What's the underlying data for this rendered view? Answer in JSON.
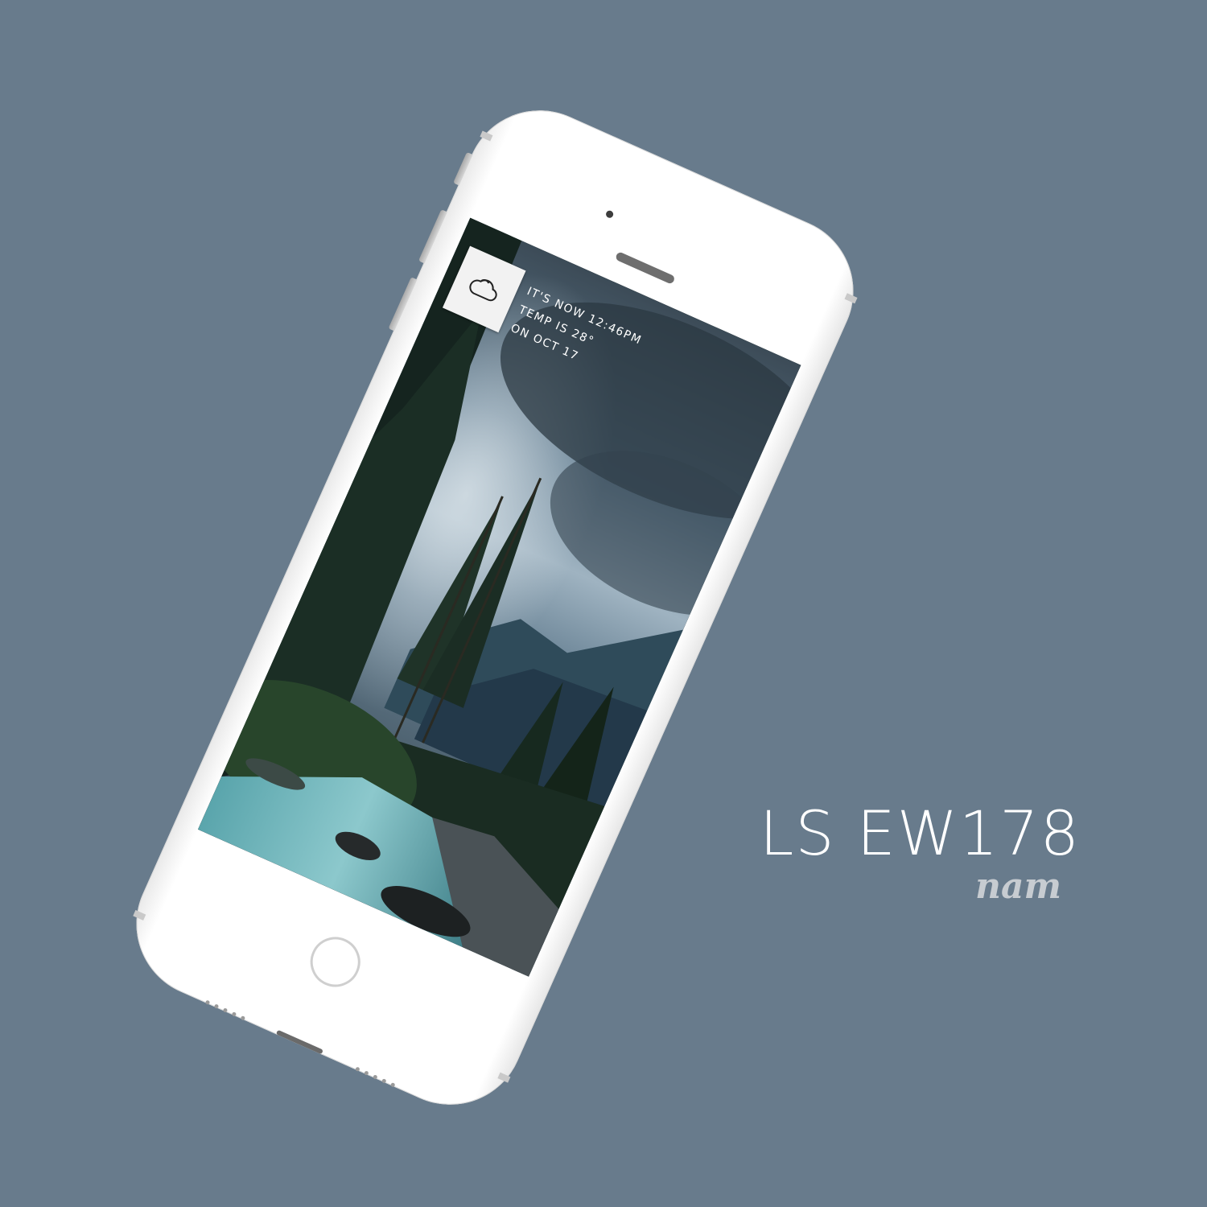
{
  "background_color": "#687b8c",
  "phone": {
    "color": "#ffffff",
    "wallpaper": "stormy sky over pine forest and turquoise mountain river"
  },
  "widget": {
    "icon": "cloud-icon",
    "lines": [
      "It's now 12:46pm",
      "Temp is 28°",
      "On Oct 17"
    ]
  },
  "title": "LS EW178",
  "signature": "nam"
}
